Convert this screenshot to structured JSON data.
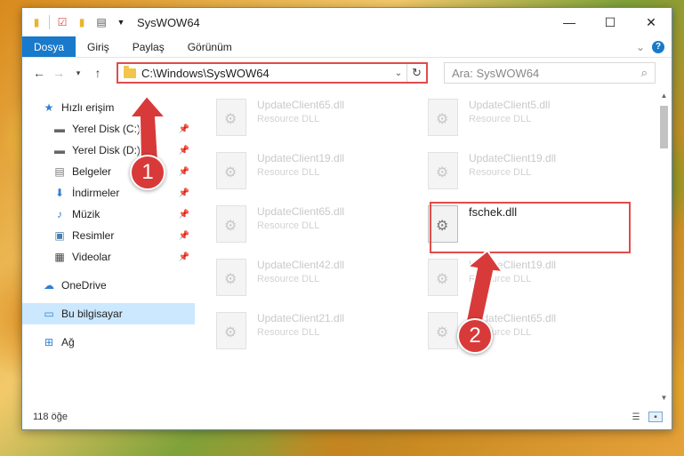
{
  "window": {
    "title": "SysWOW64",
    "minimize": "—",
    "maximize": "☐",
    "close": "✕"
  },
  "ribbon": {
    "tabs": [
      {
        "label": "Dosya",
        "active": true
      },
      {
        "label": "Giriş"
      },
      {
        "label": "Paylaş"
      },
      {
        "label": "Görünüm"
      }
    ],
    "expand": "⌄",
    "help": "?"
  },
  "nav": {
    "address_path": "C:\\Windows\\SysWOW64",
    "search_placeholder": "Ara: SysWOW64"
  },
  "sidebar": {
    "quick_access": "Hızlı erişim",
    "items": [
      {
        "label": "Yerel Disk (C:)",
        "icon": "drive-icon"
      },
      {
        "label": "Yerel Disk (D:)",
        "icon": "drive-icon"
      },
      {
        "label": "Belgeler",
        "icon": "documents-icon"
      },
      {
        "label": "İndirmeler",
        "icon": "download-icon"
      },
      {
        "label": "Müzik",
        "icon": "music-icon"
      },
      {
        "label": "Resimler",
        "icon": "pictures-icon"
      },
      {
        "label": "Videolar",
        "icon": "videos-icon"
      }
    ],
    "onedrive": "OneDrive",
    "this_pc": "Bu bilgisayar",
    "network": "Ağ"
  },
  "files": [
    {
      "name": "UpdateClient65.dll",
      "type": "Resource DLL"
    },
    {
      "name": "UpdateClient5.dll",
      "type": "Resource DLL"
    },
    {
      "name": "UpdateClient19.dll",
      "type": "Resource DLL"
    },
    {
      "name": "UpdateClient19.dll",
      "type": "Resource DLL"
    },
    {
      "name": "UpdateClient65.dll",
      "type": "Resource DLL"
    },
    {
      "name": "fschek.dll",
      "type": ""
    },
    {
      "name": "UpdateClient42.dll",
      "type": "Resource DLL"
    },
    {
      "name": "UpdateClient19.dll",
      "type": "Resource DLL"
    },
    {
      "name": "UpdateClient21.dll",
      "type": "Resource DLL"
    },
    {
      "name": "UpdateClient65.dll",
      "type": "Resource DLL"
    }
  ],
  "status": {
    "count": "118 öğe"
  },
  "annotations": {
    "step1": "1",
    "step2": "2",
    "color": "#d83a3a"
  }
}
